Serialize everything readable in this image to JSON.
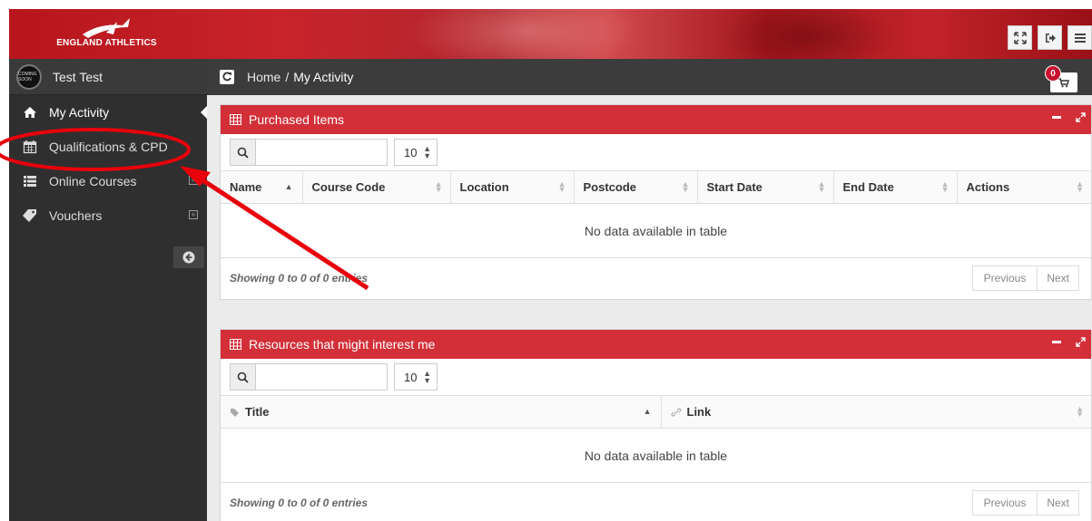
{
  "header": {
    "logo_text": "ENGLAND ATHLETICS",
    "buttons": [
      "fullscreen-icon",
      "logout-icon",
      "menu-icon"
    ]
  },
  "sidebar": {
    "user_name": "Test Test",
    "avatar_text": "COMING SOON",
    "items": [
      {
        "label": "My Activity",
        "icon": "home-icon",
        "active": true
      },
      {
        "label": "Qualifications & CPD",
        "icon": "calendar-icon"
      },
      {
        "label": "Online Courses",
        "icon": "list-icon",
        "expandable": true
      },
      {
        "label": "Vouchers",
        "icon": "ticket-icon",
        "expandable": true
      }
    ]
  },
  "breadcrumb": {
    "home": "Home",
    "separator": "/",
    "current": "My Activity"
  },
  "cart": {
    "count": "0"
  },
  "panels": {
    "purchased": {
      "title": "Purchased Items",
      "page_length": "10",
      "columns": [
        "Name",
        "Course Code",
        "Location",
        "Postcode",
        "Start Date",
        "End Date",
        "Actions"
      ],
      "empty_text": "No data available in table",
      "info": "Showing 0 to 0 of 0 entries",
      "prev": "Previous",
      "next": "Next"
    },
    "resources": {
      "title": "Resources that might interest me",
      "page_length": "10",
      "columns": [
        "Title",
        "Link"
      ],
      "empty_text": "No data available in table",
      "info": "Showing 0 to 0 of 0 entries",
      "prev": "Previous",
      "next": "Next"
    }
  },
  "colors": {
    "brand_red": "#d32f38",
    "sidebar_bg": "#2f2f2f",
    "annotation_red": "#e8000b"
  }
}
